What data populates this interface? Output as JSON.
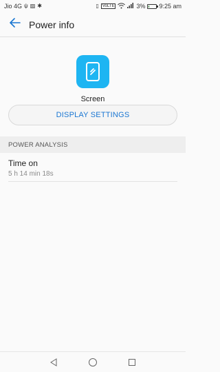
{
  "status_bar": {
    "carrier": "Jio 4G",
    "battery_percent": "3%",
    "time": "9:25 am",
    "icons": [
      "usb-icon",
      "no-sim-icon",
      "settings-icon",
      "vibrate-icon",
      "volte-icon",
      "wifi-icon",
      "signal-icon",
      "battery-icon"
    ],
    "volte_label": "VoLTE"
  },
  "app_bar": {
    "title": "Power info",
    "back_icon": "back-arrow-icon"
  },
  "hero": {
    "icon": "screen-icon",
    "label": "Screen",
    "color": "#1eb5f2"
  },
  "display_button": {
    "label": "DISPLAY SETTINGS",
    "color": "#1976d2"
  },
  "section": {
    "header": "POWER ANALYSIS"
  },
  "rows": [
    {
      "title": "Time on",
      "value": "5 h 14 min 18s"
    }
  ],
  "nav": {
    "back": "back-triangle-icon",
    "home": "home-circle-icon",
    "recents": "recents-square-icon"
  }
}
